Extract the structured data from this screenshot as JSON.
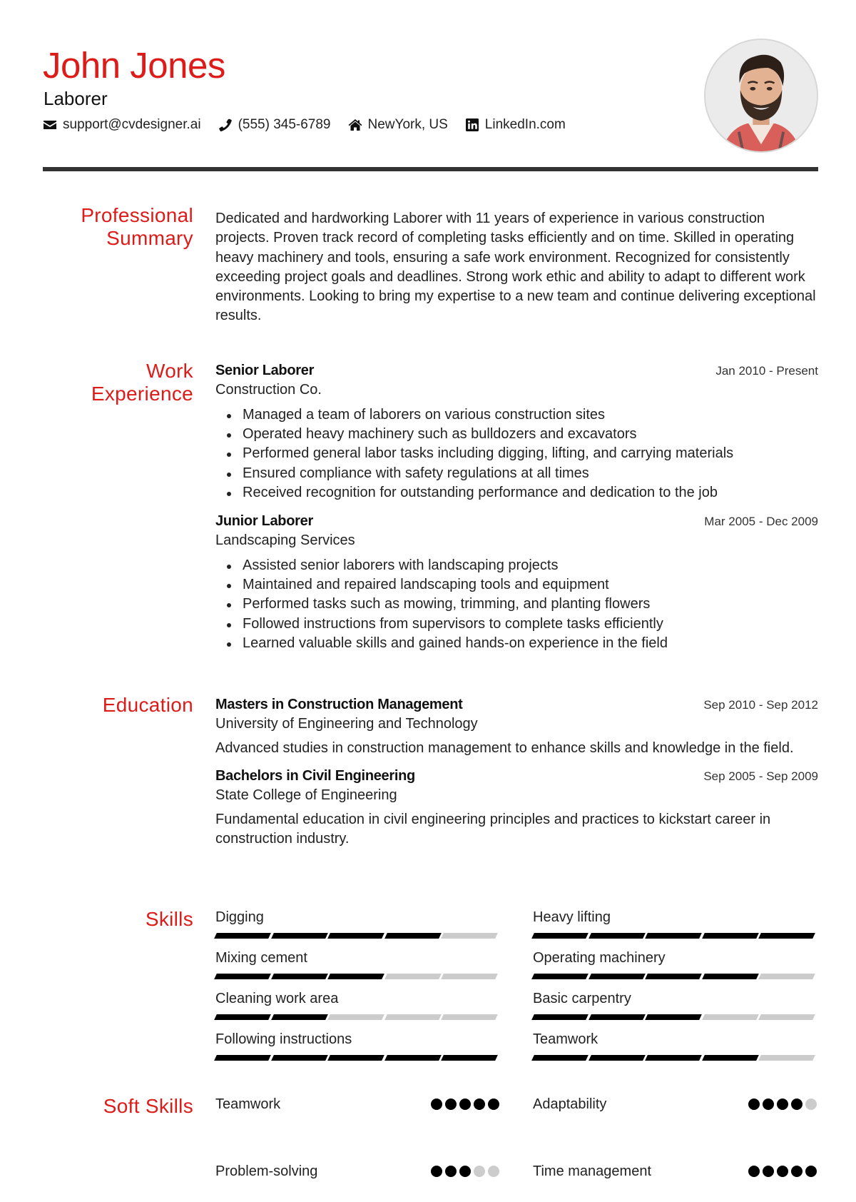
{
  "header": {
    "name": "John Jones",
    "role": "Laborer",
    "contacts": [
      {
        "icon": "envelope-icon",
        "text": "support@cvdesigner.ai"
      },
      {
        "icon": "phone-icon",
        "text": "(555) 345-6789"
      },
      {
        "icon": "home-icon",
        "text": "NewYork, US"
      },
      {
        "icon": "linkedin-icon",
        "text": "LinkedIn.com"
      }
    ],
    "accent_color": "#dd1c1a"
  },
  "summary": {
    "title_line1": "Professional",
    "title_line2": "Summary",
    "text": "Dedicated and hardworking Laborer with 11 years of experience in various construction projects. Proven track record of completing tasks efficiently and on time. Skilled in operating heavy machinery and tools, ensuring a safe work environment. Recognized for consistently exceeding project goals and deadlines. Strong work ethic and ability to adapt to different work environments. Looking to bring my expertise to a new team and continue delivering exceptional results."
  },
  "experience": {
    "title_line1": "Work",
    "title_line2": "Experience",
    "jobs": [
      {
        "title": "Senior Laborer",
        "company": "Construction Co.",
        "dates": "Jan 2010 - Present",
        "bullets": [
          "Managed a team of laborers on various construction sites",
          "Operated heavy machinery such as bulldozers and excavators",
          "Performed general labor tasks including digging, lifting, and carrying materials",
          "Ensured compliance with safety regulations at all times",
          "Received recognition for outstanding performance and dedication to the job"
        ]
      },
      {
        "title": "Junior Laborer",
        "company": "Landscaping Services",
        "dates": "Mar 2005 - Dec 2009",
        "bullets": [
          "Assisted senior laborers with landscaping projects",
          "Maintained and repaired landscaping tools and equipment",
          "Performed tasks such as mowing, trimming, and planting flowers",
          "Followed instructions from supervisors to complete tasks efficiently",
          "Learned valuable skills and gained hands-on experience in the field"
        ]
      }
    ]
  },
  "education": {
    "title": "Education",
    "items": [
      {
        "degree": "Masters in Construction Management",
        "school": "University of Engineering and Technology",
        "dates": "Sep 2010 - Sep 2012",
        "description": "Advanced studies in construction management to enhance skills and knowledge in the field."
      },
      {
        "degree": "Bachelors in Civil Engineering",
        "school": "State College of Engineering",
        "dates": "Sep 2005 - Sep 2009",
        "description": "Fundamental education in civil engineering principles and practices to kickstart career in construction industry."
      }
    ]
  },
  "skills": {
    "title": "Skills",
    "max_level": 5,
    "items": [
      {
        "name": "Digging",
        "level": 4
      },
      {
        "name": "Heavy lifting",
        "level": 5
      },
      {
        "name": "Mixing cement",
        "level": 3
      },
      {
        "name": "Operating machinery",
        "level": 4
      },
      {
        "name": "Cleaning work area",
        "level": 2
      },
      {
        "name": "Basic carpentry",
        "level": 3
      },
      {
        "name": "Following instructions",
        "level": 5
      },
      {
        "name": "Teamwork",
        "level": 4
      }
    ]
  },
  "soft_skills": {
    "title": "Soft Skills",
    "max_level": 5,
    "items": [
      {
        "name": "Teamwork",
        "level": 5
      },
      {
        "name": "Adaptability",
        "level": 4
      },
      {
        "name": "Problem-solving",
        "level": 3
      },
      {
        "name": "Time management",
        "level": 5
      }
    ]
  }
}
